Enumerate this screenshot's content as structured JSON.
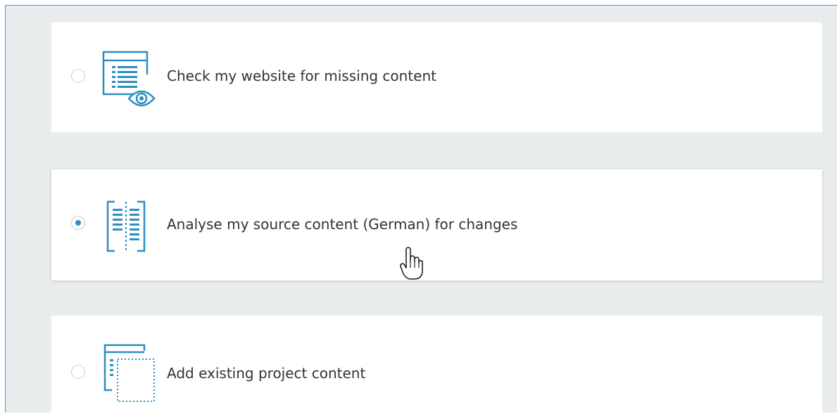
{
  "options": [
    {
      "label": "Check my website for missing content",
      "selected": false,
      "icon": "document-eye-icon"
    },
    {
      "label": "Analyse my source content (German) for changes",
      "selected": true,
      "icon": "source-columns-icon"
    },
    {
      "label": "Add existing project content",
      "selected": false,
      "icon": "add-content-icon"
    }
  ],
  "colors": {
    "accent": "#2b8fc0",
    "panel_border": "#3aa3c9",
    "panel_bg": "#e9eced",
    "card_bg": "#ffffff",
    "text": "#333333"
  }
}
